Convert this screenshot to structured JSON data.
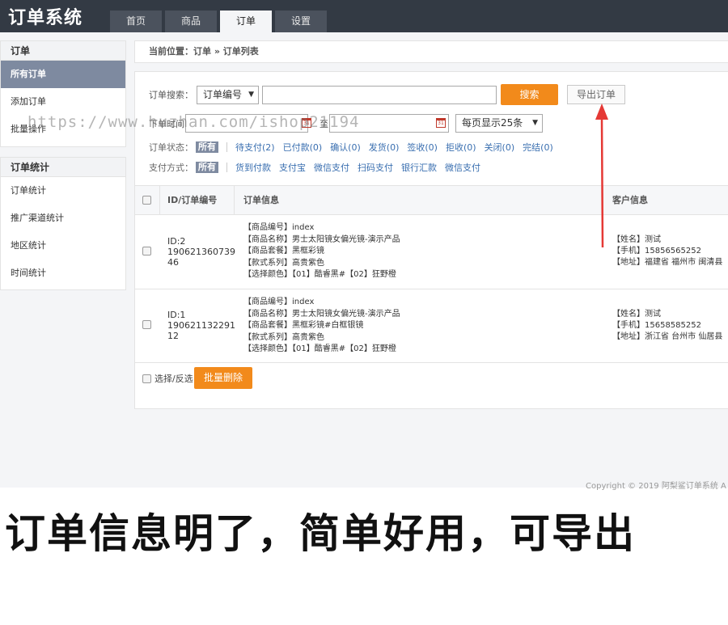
{
  "app": {
    "title": "订单系统"
  },
  "nav": {
    "tabs": [
      "首页",
      "商品",
      "订单",
      "设置"
    ],
    "active": 2
  },
  "sidebar": {
    "section1": {
      "title": "订单",
      "items": [
        "所有订单",
        "添加订单",
        "批量操作"
      ],
      "active": 0
    },
    "section2": {
      "title": "订单统计",
      "items": [
        "订单统计",
        "推广渠道统计",
        "地区统计",
        "时间统计"
      ]
    }
  },
  "breadcrumb": "当前位置：订单 » 订单列表",
  "search": {
    "label": "订单搜索：",
    "field_select": "订单编号",
    "query_value": "",
    "search_button": "搜索",
    "export_button": "导出订单",
    "time_label": "下单时间",
    "range_sep": "至",
    "per_page": "每页显示25条"
  },
  "status_filter": {
    "label": "订单状态：",
    "all": "所有",
    "options": [
      "待支付(2)",
      "已付款(0)",
      "确认(0)",
      "发货(0)",
      "签收(0)",
      "拒收(0)",
      "关闭(0)",
      "完结(0)"
    ]
  },
  "payment_filter": {
    "label": "支付方式：",
    "all": "所有",
    "options": [
      "货到付款",
      "支付宝",
      "微信支付",
      "扫码支付",
      "银行汇款",
      "微信支付"
    ]
  },
  "table": {
    "headers": [
      "ID/订单编号",
      "订单信息",
      "客户信息"
    ],
    "rows": [
      {
        "id": "ID:2",
        "order_no_1": "190621360739",
        "order_no_2": "46",
        "info": [
          "【商品编号】index",
          "【商品名称】男士太阳镜女偏光镜-演示产品",
          "【商品套餐】黑框彩镜",
          "【款式系列】高贵紫色",
          "【选择颜色】【01】酷睿黑#【02】狂野橙"
        ],
        "customer": [
          "【姓名】测试",
          "【手机】15856565252",
          "【地址】福建省 福州市 闽清县"
        ]
      },
      {
        "id": "ID:1",
        "order_no_1": "190621132291",
        "order_no_2": "12",
        "info": [
          "【商品编号】index",
          "【商品名称】男士太阳镜女偏光镜-演示产品",
          "【商品套餐】黑框彩镜#白框银镜",
          "【款式系列】高贵紫色",
          "【选择颜色】【01】酷睿黑#【02】狂野橙"
        ],
        "customer": [
          "【姓名】测试",
          "【手机】15658585252",
          "【地址】浙江省 台州市 仙居县"
        ]
      }
    ]
  },
  "bulk": {
    "select_label": "选择/反选",
    "delete_button": "批量删除"
  },
  "footer": {
    "copyright": "Copyright © 2019 阿梨鲨订单系统 A"
  },
  "watermark": "https://www.huzhan.com/ishop21194",
  "caption": "订单信息明了，简单好用，可导出",
  "colors": {
    "topbar": "#333a44",
    "accent_orange": "#f28a1b",
    "link_blue": "#3a6fb0",
    "arrow_red": "#e53935"
  }
}
